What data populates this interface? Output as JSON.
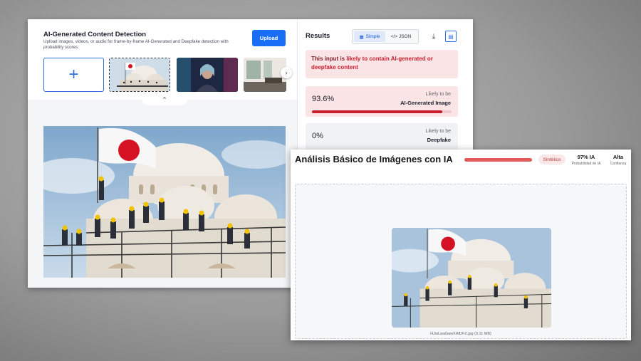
{
  "detector": {
    "title": "AI-Generated Content Detection",
    "description": "Upload images, videos, or audio for frame-by-frame AI-Generated and Deepfake detection with probability scores.",
    "upload_label": "Upload",
    "add_symbol": "+",
    "next_arrow": "›",
    "collapse_arrow": "⌃"
  },
  "results": {
    "title": "Results",
    "toggle_simple": "Simple",
    "toggle_json": "</> JSON",
    "alert_prefix": "This input is ",
    "alert_highlight": "likely to contain AI-generated or deepfake content",
    "cards": [
      {
        "pct": "93.6%",
        "label1": "Likely to be",
        "label2": "AI-Generated Image",
        "value": 0.936
      },
      {
        "pct": "0%",
        "label1": "Likely to be",
        "label2": "Deepfake",
        "value": 0.0
      }
    ]
  },
  "analysis": {
    "title": "Análisis Básico de Imágenes con IA",
    "badge": "Sintético",
    "stat1_value": "97% IA",
    "stat1_label": "Probabilidad de IA",
    "stat2_value": "Alta",
    "stat2_label": "Confianza",
    "filename": "HJwLwaGawXAfDFZ.jpg (0.11 MB)"
  },
  "colors": {
    "accent": "#1a6ef5",
    "danger": "#c81e2e",
    "alert_bg": "#fbe4e6"
  }
}
